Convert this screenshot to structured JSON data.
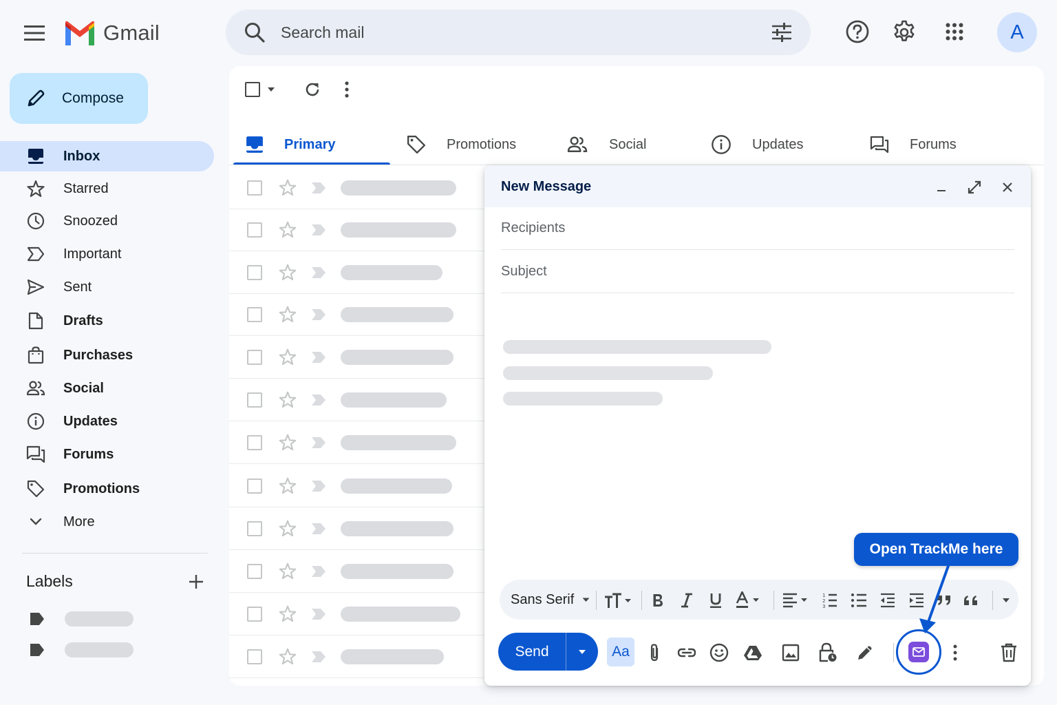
{
  "app": {
    "name": "Gmail",
    "avatar_letter": "A"
  },
  "search": {
    "placeholder": "Search mail"
  },
  "compose_button": {
    "label": "Compose"
  },
  "sidebar": {
    "items": [
      {
        "label": "Inbox",
        "icon": "inbox-icon",
        "active": true
      },
      {
        "label": "Starred",
        "icon": "star-icon"
      },
      {
        "label": "Snoozed",
        "icon": "clock-icon"
      },
      {
        "label": "Important",
        "icon": "important-icon"
      },
      {
        "label": "Sent",
        "icon": "send-icon"
      },
      {
        "label": "Drafts",
        "icon": "file-icon"
      },
      {
        "label": "Purchases",
        "icon": "shopping-bag-icon"
      },
      {
        "label": "Social",
        "icon": "people-icon"
      },
      {
        "label": "Updates",
        "icon": "info-icon"
      },
      {
        "label": "Forums",
        "icon": "forum-icon"
      },
      {
        "label": "Promotions",
        "icon": "tag-icon"
      },
      {
        "label": "More",
        "icon": "chevron-down-icon"
      }
    ],
    "labels_heading": "Labels"
  },
  "tabs": [
    {
      "label": "Primary",
      "icon": "inbox-icon",
      "active": true
    },
    {
      "label": "Promotions",
      "icon": "tag-icon"
    },
    {
      "label": "Social",
      "icon": "people-icon"
    },
    {
      "label": "Updates",
      "icon": "info-icon"
    },
    {
      "label": "Forums",
      "icon": "forum-icon"
    }
  ],
  "compose_window": {
    "title": "New Message",
    "recipients_placeholder": "Recipients",
    "subject_placeholder": "Subject",
    "font_name": "Sans Serif",
    "send_label": "Send",
    "formatting_label": "Aa"
  },
  "callout": {
    "text": "Open TrackMe here"
  },
  "colors": {
    "accent": "#0b57d0",
    "compose_bg": "#c2e7ff",
    "active_nav_bg": "#d3e3fd",
    "trackme": "#7c4ddc"
  }
}
